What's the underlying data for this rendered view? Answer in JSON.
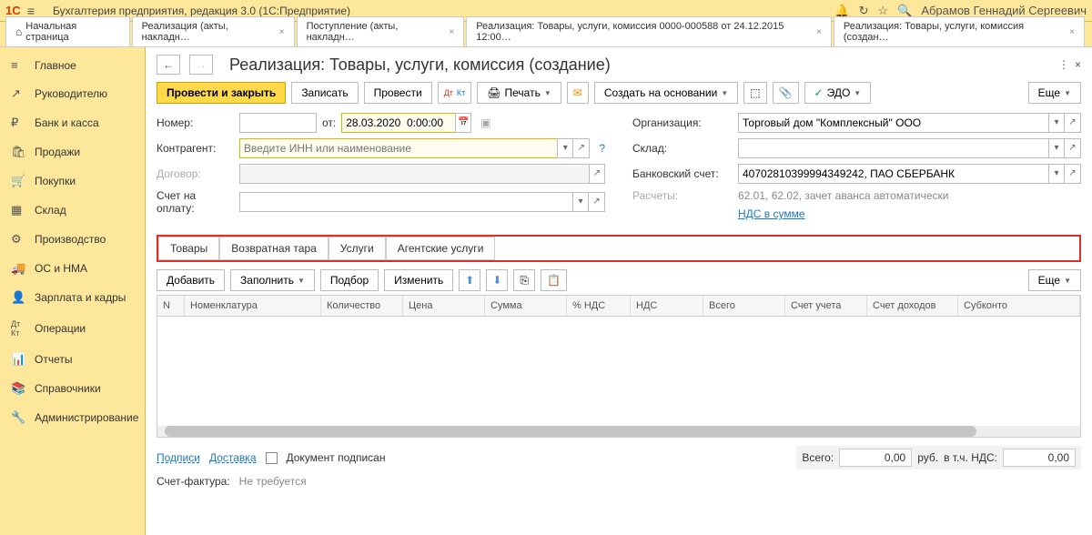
{
  "app": {
    "title": "Бухгалтерия предприятия, редакция 3.0   (1С:Предприятие)",
    "user": "Абрамов Геннадий Сергеевич"
  },
  "tabs": [
    {
      "label": "Начальная страница",
      "home": true
    },
    {
      "label": "Реализация (акты, накладн…",
      "closable": true
    },
    {
      "label": "Поступление (акты, накладн…",
      "closable": true
    },
    {
      "label": "Реализация: Товары, услуги, комиссия 0000-000588 от 24.12.2015 12:00…",
      "closable": true
    },
    {
      "label": "Реализация: Товары, услуги, комиссия (создан…",
      "closable": true,
      "active": true
    }
  ],
  "sidebar": [
    {
      "icon": "≡",
      "label": "Главное"
    },
    {
      "icon": "↗",
      "label": "Руководителю"
    },
    {
      "icon": "₽",
      "label": "Банк и касса"
    },
    {
      "icon": "🛍",
      "label": "Продажи"
    },
    {
      "icon": "🛒",
      "label": "Покупки"
    },
    {
      "icon": "▦",
      "label": "Склад"
    },
    {
      "icon": "⚙",
      "label": "Производство"
    },
    {
      "icon": "🚚",
      "label": "ОС и НМА"
    },
    {
      "icon": "👤",
      "label": "Зарплата и кадры"
    },
    {
      "icon": "Дт",
      "label": "Операции"
    },
    {
      "icon": "📊",
      "label": "Отчеты"
    },
    {
      "icon": "📚",
      "label": "Справочники"
    },
    {
      "icon": "🔧",
      "label": "Администрирование"
    }
  ],
  "page": {
    "title": "Реализация: Товары, услуги, комиссия (создание)"
  },
  "toolbar": {
    "post_close": "Провести и закрыть",
    "write": "Записать",
    "post": "Провести",
    "print": "Печать",
    "create_based": "Создать на основании",
    "edo": "ЭДО",
    "more": "Еще"
  },
  "form": {
    "number_label": "Номер:",
    "from_label": "от:",
    "date_value": "28.03.2020  0:00:00",
    "contragent_label": "Контрагент:",
    "contragent_placeholder": "Введите ИНН или наименование",
    "contract_label": "Договор:",
    "invoice_label": "Счет на оплату:",
    "org_label": "Организация:",
    "org_value": "Торговый дом \"Комплексный\" ООО",
    "warehouse_label": "Склад:",
    "bank_label": "Банковский счет:",
    "bank_value": "40702810399994349242, ПАО СБЕРБАНК",
    "settle_label": "Расчеты:",
    "settle_value": "62.01, 62.02, зачет аванса автоматически",
    "vat_link": "НДС в сумме"
  },
  "subtabs": [
    "Товары",
    "Возвратная тара",
    "Услуги",
    "Агентские услуги"
  ],
  "tbl_toolbar": {
    "add": "Добавить",
    "fill": "Заполнить",
    "select": "Подбор",
    "change": "Изменить",
    "more": "Еще"
  },
  "columns": [
    "N",
    "Номенклатура",
    "Количество",
    "Цена",
    "Сумма",
    "% НДС",
    "НДС",
    "Всего",
    "Счет учета",
    "Счет доходов",
    "Субконто"
  ],
  "footer": {
    "sign": "Подписи",
    "delivery": "Доставка",
    "doc_signed": "Документ подписан",
    "total_label": "Всего:",
    "total_value": "0,00",
    "currency": "руб.",
    "vat_label": "в т.ч. НДС:",
    "vat_value": "0,00",
    "sf_label": "Счет-фактура:",
    "sf_value": "Не требуется"
  }
}
